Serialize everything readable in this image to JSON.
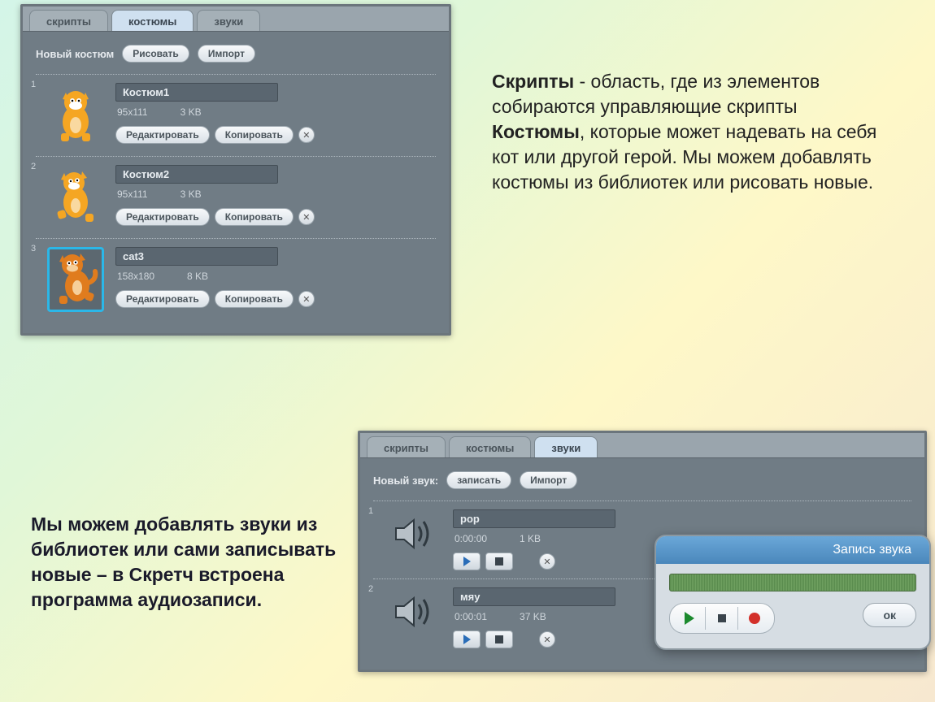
{
  "costumes_panel": {
    "tabs": {
      "scripts": "скрипты",
      "costumes": "костюмы",
      "sounds": "звуки"
    },
    "active_tab": "costumes",
    "new_label": "Новый костюм",
    "draw_btn": "Рисовать",
    "import_btn": "Импорт",
    "edit_btn": "Редактировать",
    "copy_btn": "Копировать",
    "items": [
      {
        "idx": "1",
        "name": "Костюм1",
        "dims": "95x111",
        "size": "3 KB"
      },
      {
        "idx": "2",
        "name": "Костюм2",
        "dims": "95x111",
        "size": "3 KB"
      },
      {
        "idx": "3",
        "name": "cat3",
        "dims": "158x180",
        "size": "8 KB"
      }
    ]
  },
  "desc_right": {
    "bold1": "Скрипты",
    "t1": " - область, где из элементов собираются управляющие скрипты",
    "bold2": "Костюмы",
    "t2": ", которые может надевать на себя кот или другой герой. Мы можем добавлять костюмы из библиотек или рисовать новые."
  },
  "desc_left": "Мы можем добавлять звуки из библиотек или сами записывать новые – в Скретч встроена программа аудиозаписи.",
  "sounds_panel": {
    "tabs": {
      "scripts": "скрипты",
      "costumes": "костюмы",
      "sounds": "звуки"
    },
    "new_label": "Новый звук:",
    "record_btn": "записать",
    "import_btn": "Импорт",
    "items": [
      {
        "idx": "1",
        "name": "pop",
        "time": "0:00:00",
        "size": "1 KB"
      },
      {
        "idx": "2",
        "name": "мяу",
        "time": "0:00:01",
        "size": "37 KB"
      }
    ]
  },
  "recorder": {
    "title": "Запись звука",
    "ok": "ок"
  }
}
